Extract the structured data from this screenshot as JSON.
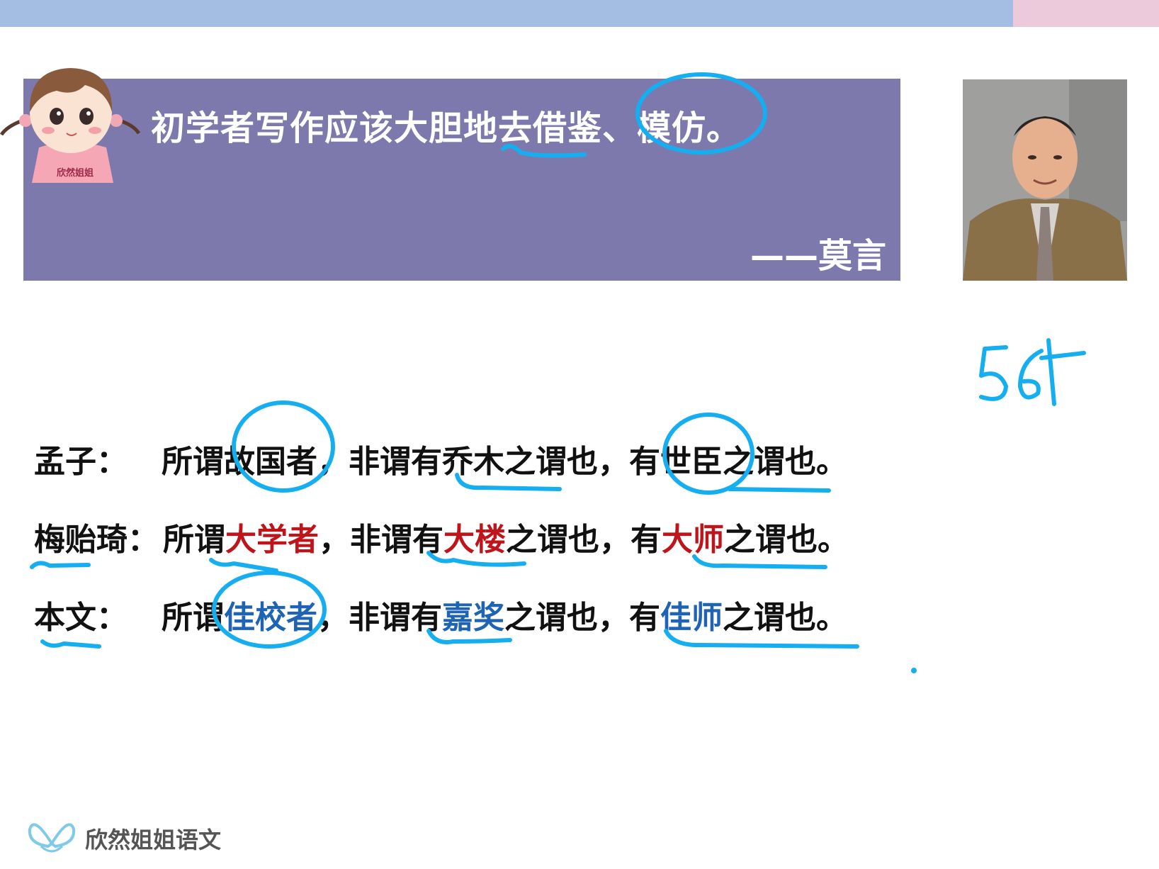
{
  "quote": {
    "text": "初学者写作应该大胆地去借鉴、模仿。",
    "author": "——莫言"
  },
  "lines": [
    {
      "speaker": "孟子：",
      "parts": [
        "所谓",
        "故国者",
        "，非谓有",
        "乔木",
        "之谓也，有",
        "世臣",
        "之谓也。"
      ],
      "highlight_color": "none"
    },
    {
      "speaker": "梅贻琦：",
      "parts": [
        "所谓",
        "大学者",
        "，非谓有",
        "大楼",
        "之谓也，有",
        "大师",
        "之谓也。"
      ],
      "highlight_color": "#c0141b"
    },
    {
      "speaker": "本文：",
      "parts": [
        "所谓",
        "佳校者",
        "，非谓有",
        "嘉奖",
        "之谓也，有",
        "佳师",
        "之谓也。"
      ],
      "highlight_color": "#1f63b5"
    }
  ],
  "handwriting": {
    "note": "56t"
  },
  "girl_shirt_text": "欣然姐姐",
  "logo": {
    "text": "欣然姐姐语文"
  },
  "colors": {
    "top_bar": "#a3bde3",
    "top_bar_accent": "#eccadb",
    "quote_background": "#7d79ac",
    "annotation_ink": "#15aef0"
  }
}
